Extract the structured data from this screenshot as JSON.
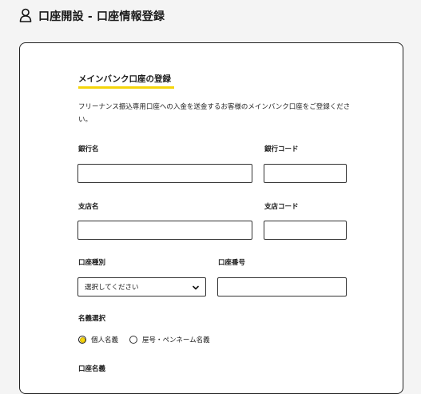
{
  "header": {
    "title": "口座開設 - 口座情報登録"
  },
  "section": {
    "title": "メインバンク口座の登録",
    "description": "フリーナンス振込専用口座への入金を送金するお客様のメインバンク口座をご登録ください。"
  },
  "fields": {
    "bank_name_label": "銀行名",
    "bank_code_label": "銀行コード",
    "branch_name_label": "支店名",
    "branch_code_label": "支店コード",
    "account_type_label": "口座種別",
    "account_type_selected": "選択してください",
    "account_number_label": "口座番号",
    "name_type_label": "名義選択",
    "name_type_options": [
      "個人名義",
      "屋号・ペンネーム名義"
    ],
    "account_holder_label": "口座名義"
  },
  "colors": {
    "accent": "#f5d50a",
    "border": "#222222"
  }
}
